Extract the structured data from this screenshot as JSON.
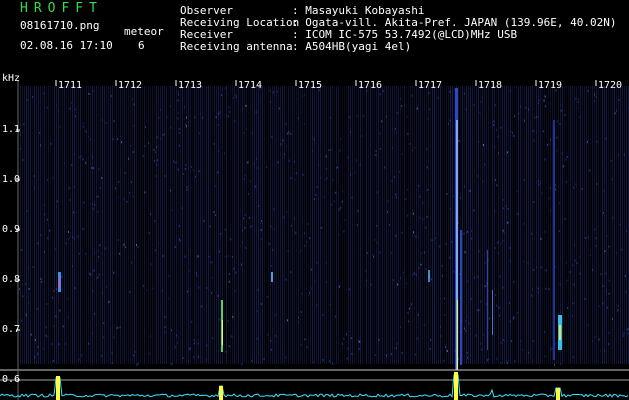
{
  "header": {
    "brand": "HROFFT",
    "filename": "08161710.png",
    "datetime": "02.08.16 17:10",
    "meteor_label": "meteor",
    "meteor_count": "6",
    "fields": [
      {
        "label": "Observer",
        "value": ": Masayuki Kobayashi"
      },
      {
        "label": "Receiving Location",
        "value": ": Ogata-vill. Akita-Pref. JAPAN (139.96E, 40.02N)"
      },
      {
        "label": "Receiver",
        "value": ": ICOM IC-575 53.7492(@LCD)MHz USB"
      },
      {
        "label": "Receiving antenna",
        "value": ": A504HB(yagi 4el)"
      }
    ]
  },
  "axes": {
    "y_unit": "kHz",
    "y_ticks": [
      "1.1",
      "1.0",
      "0.9",
      "0.8",
      "0.7",
      "0.6"
    ],
    "x_ticks": [
      "1711",
      "1712",
      "1713",
      "1714",
      "1715",
      "1716",
      "1717",
      "1718",
      "1719",
      "1720"
    ]
  },
  "colors": {
    "background": "#000000",
    "noise": "#2a3a9a",
    "signal_hot": "#ffff40",
    "trace": "#40e0ff",
    "header_green": "#33dd44"
  },
  "events": [
    {
      "time": "1711",
      "freq_khz": 0.8
    },
    {
      "time": "1713",
      "freq_khz": 0.7
    },
    {
      "time": "1717",
      "freq_khz": 0.9
    },
    {
      "time": "1717",
      "freq_khz": 0.75
    },
    {
      "time": "1719",
      "freq_khz": 0.7
    }
  ]
}
